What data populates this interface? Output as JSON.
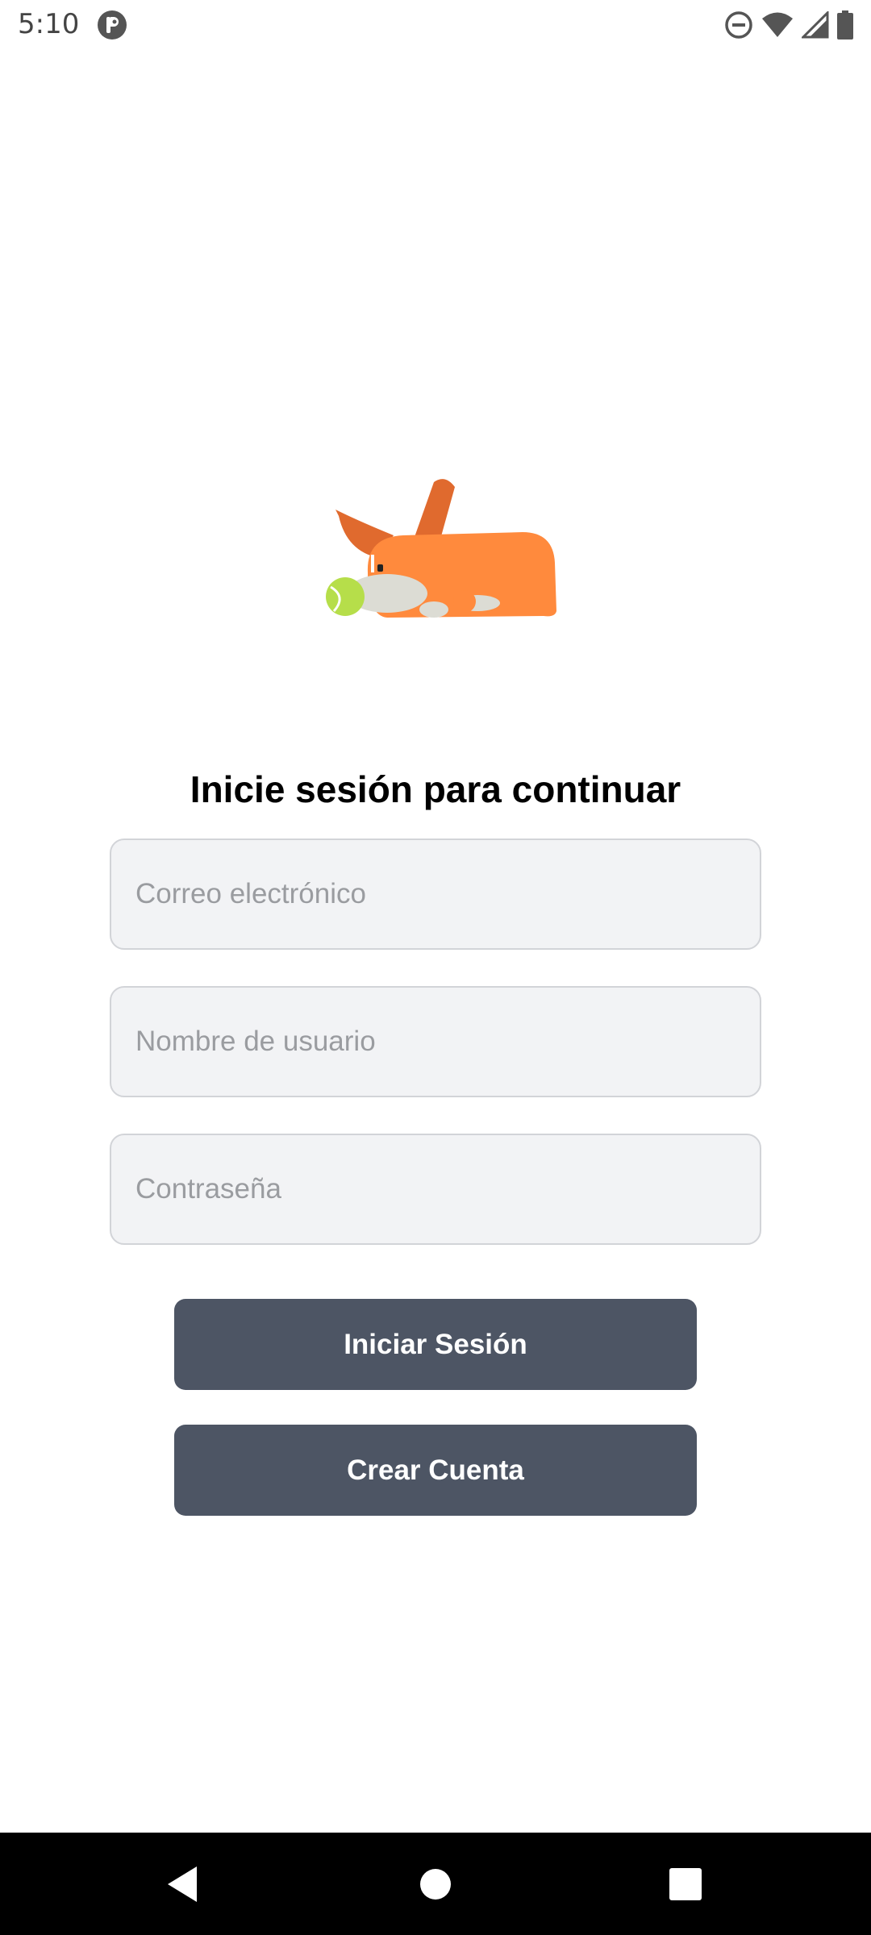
{
  "status_bar": {
    "time": "5:10",
    "icons": [
      "app-notification-icon",
      "do-not-disturb-icon",
      "wifi-icon",
      "cellular-signal-icon",
      "battery-icon"
    ]
  },
  "mascot": {
    "name": "sleeping-dog-with-ball",
    "colors": {
      "body": "#ff8a3d",
      "ear": "#e06a2e",
      "ball": "#b6de4a",
      "muzzle": "#dcdcd4"
    }
  },
  "login": {
    "title": "Inicie sesión para continuar",
    "email_placeholder": "Correo electrónico",
    "username_placeholder": "Nombre de usuario",
    "password_placeholder": "Contraseña",
    "login_button": "Iniciar Sesión",
    "register_button": "Crear Cuenta"
  },
  "colors": {
    "button_bg": "#4d5564",
    "field_bg": "#f2f3f5",
    "field_border": "#d2d4d8",
    "nav_bar_bg": "#000000"
  },
  "nav_bar": {
    "icons": [
      "back-icon",
      "home-icon",
      "recents-icon"
    ]
  }
}
